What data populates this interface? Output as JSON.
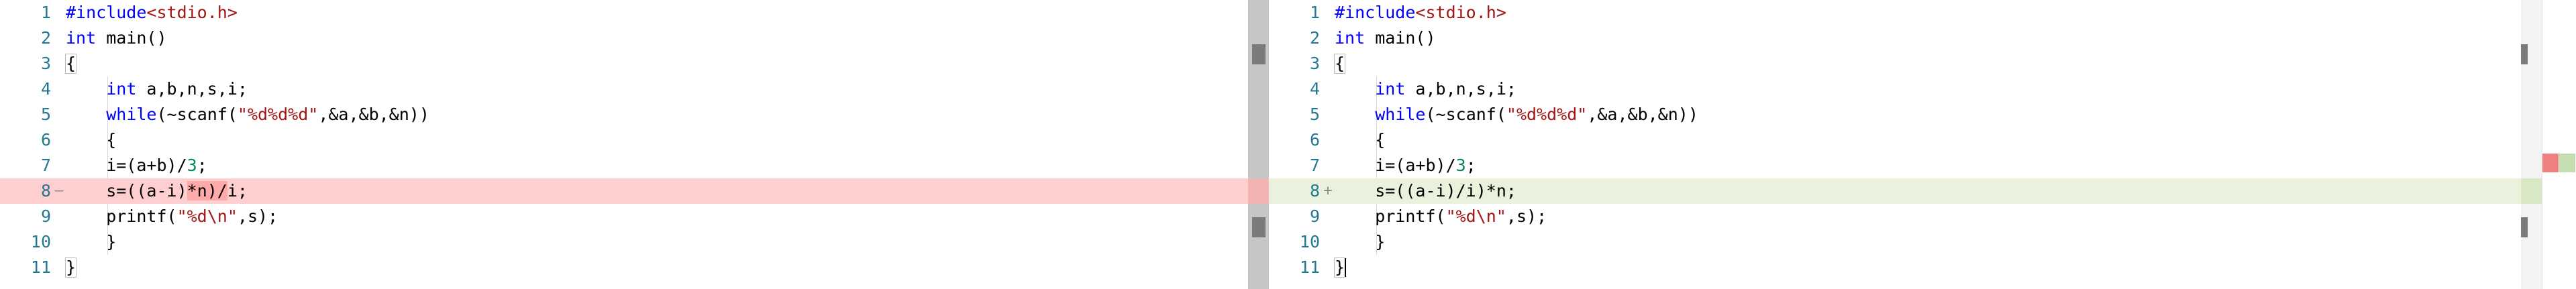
{
  "colors": {
    "deleted_line": "#ffcfcf",
    "inserted_line": "#eaf1dd",
    "line_number": "#237893",
    "keyword": "#0000ff",
    "string": "#a31515",
    "number": "#098658"
  },
  "left": {
    "line_numbers": [
      "1",
      "2",
      "3",
      "4",
      "5",
      "6",
      "7",
      "8",
      "9",
      "10",
      "11"
    ],
    "diff_marker": "—",
    "lines": {
      "l1": {
        "a": "#include",
        "b": "<stdio.h>"
      },
      "l2": {
        "a": "int",
        "b": " main()"
      },
      "l3": {
        "a": "{"
      },
      "l4": {
        "a": "    ",
        "b": "int",
        "c": " a,b,n,s,i;"
      },
      "l5": {
        "a": "    ",
        "b": "while",
        "c": "(~scanf(",
        "d": "\"%d%d%d\"",
        "e": ",&a,&b,&n))"
      },
      "l6": {
        "a": "    {"
      },
      "l7": {
        "a": "    i=(a+b)/",
        "b": "3",
        "c": ";"
      },
      "l8": {
        "a": "    s=((a-i)",
        "b": "*n)/",
        "c": "i",
        "d": ";"
      },
      "l9": {
        "a": "    printf(",
        "b": "\"%d\\n\"",
        "c": ",s);"
      },
      "l10": {
        "a": "    }"
      },
      "l11": {
        "a": "}"
      }
    }
  },
  "right": {
    "line_numbers": [
      "1",
      "2",
      "3",
      "4",
      "5",
      "6",
      "7",
      "8",
      "9",
      "10",
      "11"
    ],
    "diff_marker": "+",
    "lines": {
      "l1": {
        "a": "#include",
        "b": "<stdio.h>"
      },
      "l2": {
        "a": "int",
        "b": " main()"
      },
      "l3": {
        "a": "{"
      },
      "l4": {
        "a": "    ",
        "b": "int",
        "c": " a,b,n,s,i;"
      },
      "l5": {
        "a": "    ",
        "b": "while",
        "c": "(~scanf(",
        "d": "\"%d%d%d\"",
        "e": ",&a,&b,&n))"
      },
      "l6": {
        "a": "    {"
      },
      "l7": {
        "a": "    i=(a+b)/",
        "b": "3",
        "c": ";"
      },
      "l8": {
        "a": "    s=((a-i)/i)*n;"
      },
      "l9": {
        "a": "    printf(",
        "b": "\"%d\\n\"",
        "c": ",s);"
      },
      "l10": {
        "a": "    }"
      },
      "l11": {
        "a": "}"
      }
    }
  }
}
